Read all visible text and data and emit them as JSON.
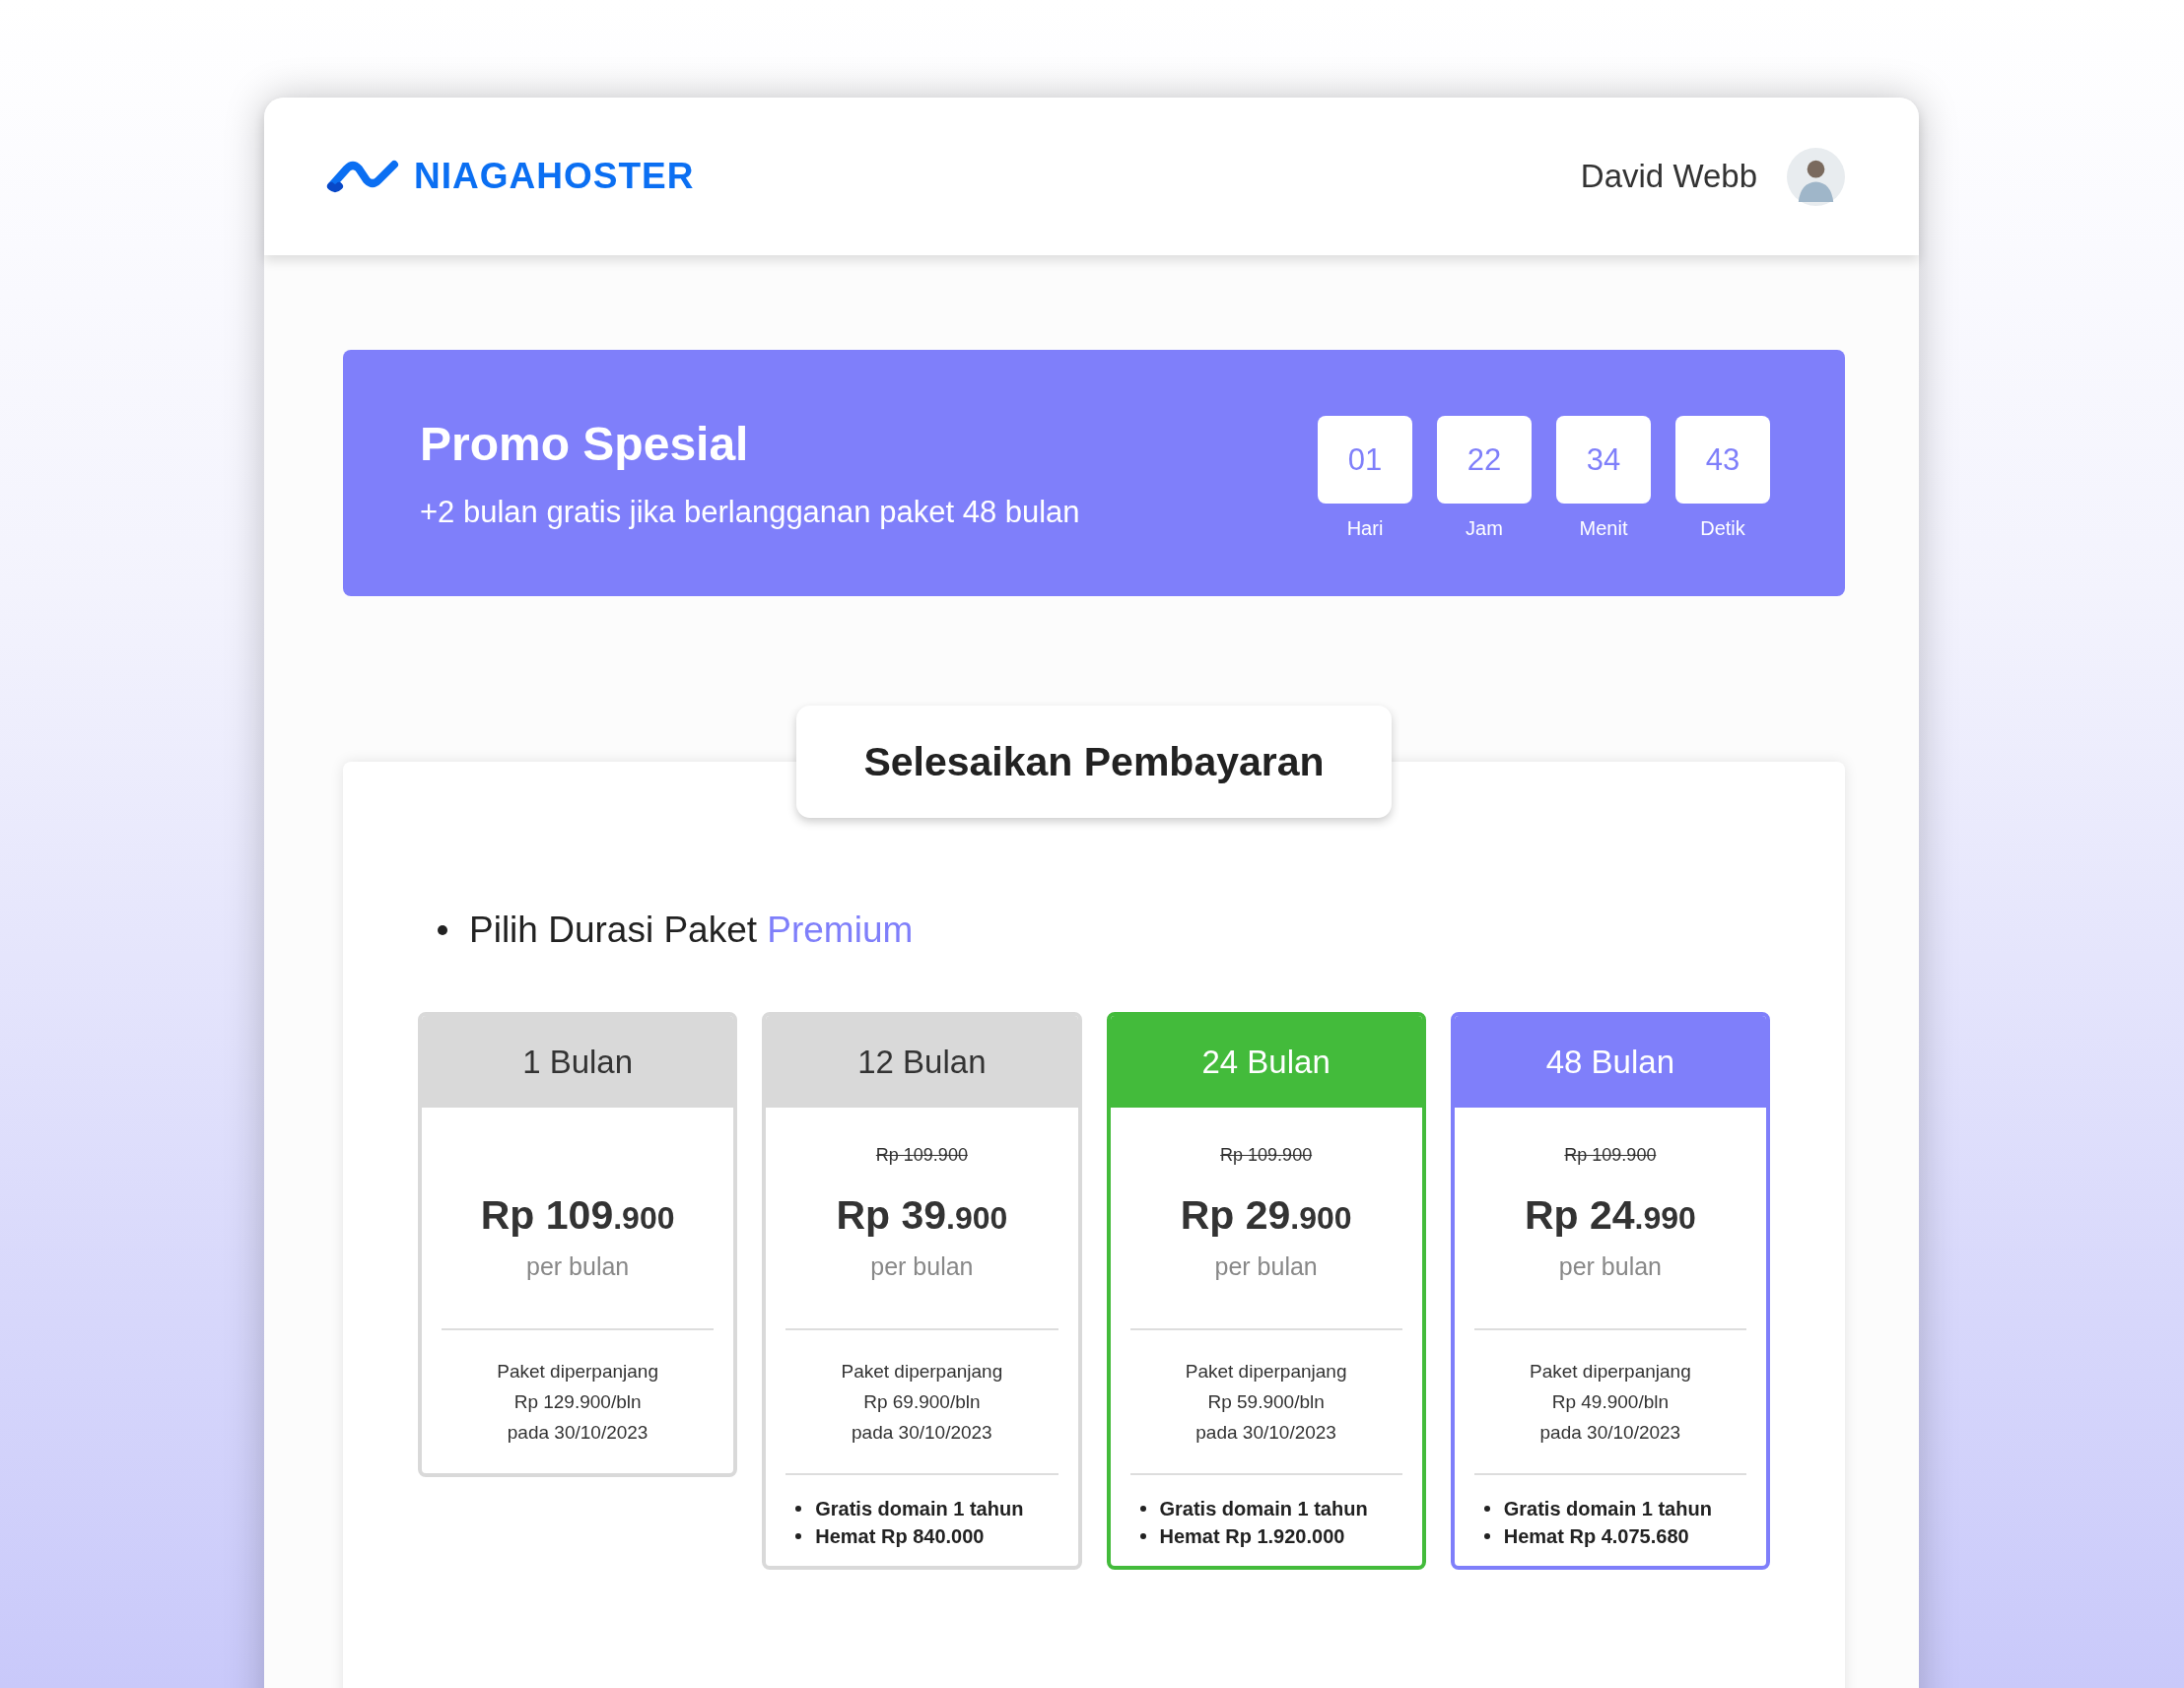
{
  "header": {
    "logo": "NIAGAHOSTER",
    "user_name": "David Webb"
  },
  "promo": {
    "title": "Promo Spesial",
    "subtitle": "+2 bulan gratis jika berlangganan paket 48 bulan",
    "countdown": [
      {
        "value": "01",
        "label": "Hari"
      },
      {
        "value": "22",
        "label": "Jam"
      },
      {
        "value": "34",
        "label": "Menit"
      },
      {
        "value": "43",
        "label": "Detik"
      }
    ]
  },
  "payment": {
    "title": "Selesaikan Pembayaran",
    "heading": "Pilih Durasi Paket **Premium**",
    "plans": [
      {
        "kind": "plain",
        "color": "#d9d9d9",
        "name": "1 Bulan",
        "price_main": "Rp 109",
        "price_fraction": ".900",
        "period": "per bulan",
        "renewal": [
          "Paket diperpanjang",
          "Rp 129.900/bln",
          "pada 30/10/2023"
        ]
      },
      {
        "kind": "plain",
        "color": "#d9d9d9",
        "name": "12 Bulan",
        "old_price": "Rp 109.900",
        "price_main": "Rp 39",
        "price_fraction": ".900",
        "period": "per bulan",
        "renewal": [
          "Paket diperpanjang",
          "Rp 69.900/bln",
          "pada 30/10/2023"
        ],
        "benefits": [
          "Gratis domain 1 tahun",
          "Hemat Rp 840.000"
        ]
      },
      {
        "kind": "highlighted",
        "color": "#43bb3b",
        "name": "24 Bulan",
        "old_price": "Rp 109.900",
        "price_main": "Rp 29",
        "price_fraction": ".900",
        "period": "per bulan",
        "renewal": [
          "Paket diperpanjang",
          "Rp 59.900/bln",
          "pada 30/10/2023"
        ],
        "benefits": [
          "Gratis domain 1 tahun",
          "Hemat Rp 1.920.000"
        ]
      },
      {
        "kind": "highlighted",
        "color": "#7f7ffa",
        "name": "48 Bulan",
        "old_price": "Rp 109.900",
        "price_main": "Rp 24",
        "price_fraction": ".990",
        "period": "per bulan",
        "renewal": [
          "Paket diperpanjang",
          "Rp 49.900/bln",
          "pada 30/10/2023"
        ],
        "benefits": [
          "Gratis domain 1 tahun",
          "Hemat Rp 4.075.680"
        ]
      }
    ]
  }
}
